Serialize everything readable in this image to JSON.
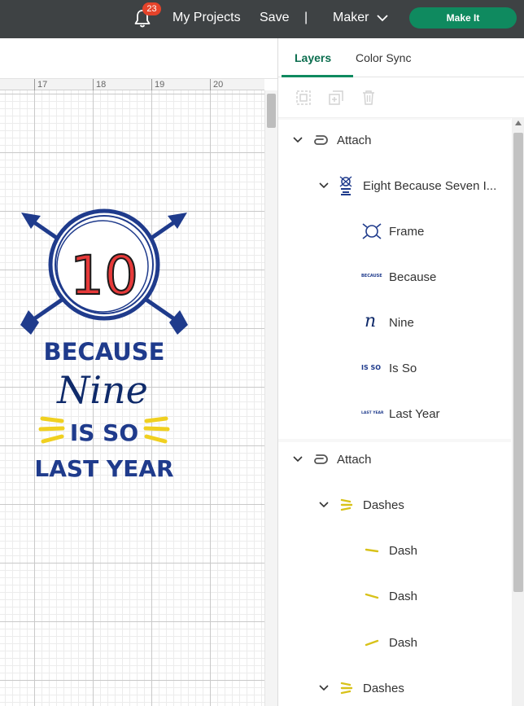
{
  "topbar": {
    "notifications_count": "23",
    "my_projects": "My Projects",
    "save": "Save",
    "separator": "|",
    "machine": "Maker",
    "make_it": "Make It"
  },
  "ruler": {
    "labels": [
      "17",
      "18",
      "19",
      "20"
    ]
  },
  "design": {
    "number": "10",
    "line1": "BECAUSE",
    "line2": "Nine",
    "line3": "IS SO",
    "line4": "LAST YEAR"
  },
  "panel": {
    "tabs": [
      {
        "label": "Layers",
        "active": true
      },
      {
        "label": "Color Sync",
        "active": false
      }
    ],
    "tools": [
      "group-icon",
      "duplicate-icon",
      "delete-icon"
    ]
  },
  "layers": {
    "group1": {
      "label": "Attach",
      "child": {
        "label": "Eight Because Seven I...",
        "items": [
          {
            "label": "Frame",
            "icon": "frame-thumb"
          },
          {
            "label": "Because",
            "icon": "because-thumb",
            "thumb_text": "BECAUSE"
          },
          {
            "label": "Nine",
            "icon": "nine-thumb",
            "thumb_text": "n"
          },
          {
            "label": "Is So",
            "icon": "is-so-thumb",
            "thumb_text": "IS SO"
          },
          {
            "label": "Last Year",
            "icon": "last-year-thumb",
            "thumb_text": "LAST YEAR"
          }
        ]
      }
    },
    "group2": {
      "label": "Attach",
      "child": {
        "label": "Dashes",
        "items": [
          {
            "label": "Dash",
            "icon": "dash-thumb"
          },
          {
            "label": "Dash",
            "icon": "dash-thumb"
          },
          {
            "label": "Dash",
            "icon": "dash-thumb"
          }
        ]
      },
      "child2": {
        "label": "Dashes"
      }
    }
  },
  "colors": {
    "topbar": "#3e4244",
    "make_it": "#0f8a5f",
    "accent": "#0c6e4f",
    "navy": "#1f3b8c",
    "red": "#e63a3a",
    "yellow": "#f0d020"
  }
}
